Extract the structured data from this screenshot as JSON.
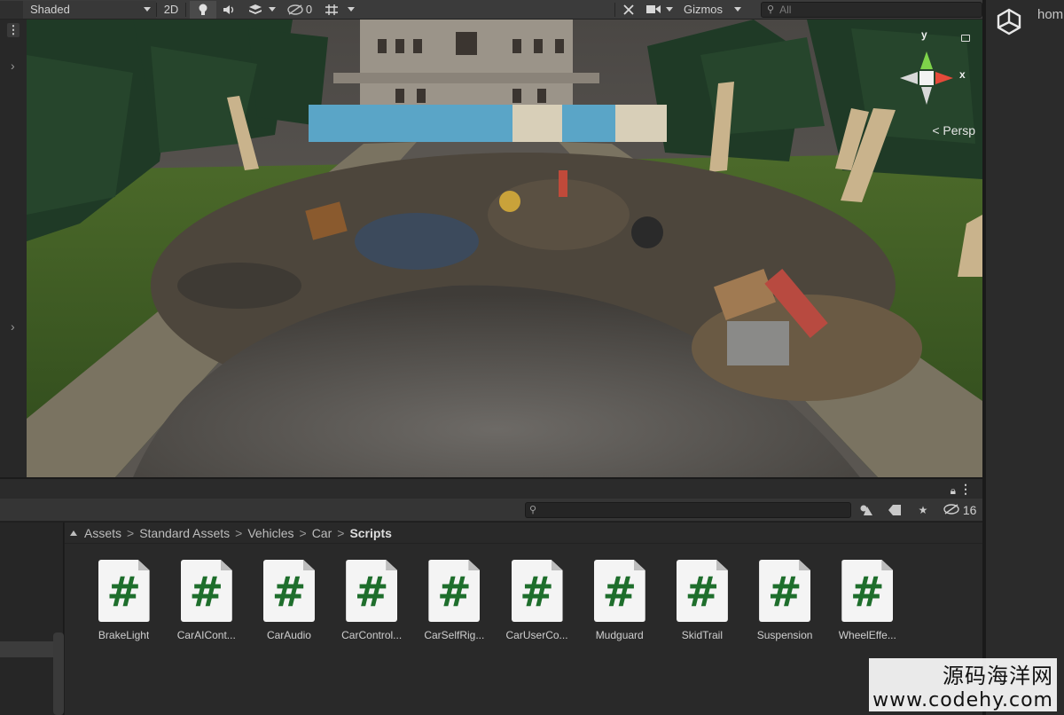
{
  "scene_toolbar": {
    "shading_mode": "Shaded",
    "mode_2d": "2D",
    "hidden_count": "0",
    "gizmos_label": "Gizmos",
    "search_placeholder": "All"
  },
  "scene_view": {
    "projection_label": "< Persp",
    "gizmo_axes": {
      "y": "y",
      "x": "x"
    }
  },
  "right_panel": {
    "title": "hom"
  },
  "project_panel": {
    "hidden_count": "16",
    "breadcrumb": [
      "Assets",
      "Standard Assets",
      "Vehicles",
      "Car"
    ],
    "breadcrumb_current": "Scripts",
    "assets": [
      {
        "label": "BrakeLight",
        "icon": "csharp-script-icon"
      },
      {
        "label": "CarAICont...",
        "icon": "csharp-script-icon"
      },
      {
        "label": "CarAudio",
        "icon": "csharp-script-icon"
      },
      {
        "label": "CarControl...",
        "icon": "csharp-script-icon"
      },
      {
        "label": "CarSelfRig...",
        "icon": "csharp-script-icon"
      },
      {
        "label": "CarUserCo...",
        "icon": "csharp-script-icon"
      },
      {
        "label": "Mudguard",
        "icon": "csharp-script-icon"
      },
      {
        "label": "SkidTrail",
        "icon": "csharp-script-icon"
      },
      {
        "label": "Suspension",
        "icon": "csharp-script-icon"
      },
      {
        "label": "WheelEffe...",
        "icon": "csharp-script-icon"
      }
    ]
  },
  "watermark": {
    "line1": "源码海洋网",
    "line2": "www.codehy.com"
  },
  "colors": {
    "script_hash": "#1e6e2c",
    "panel_bg": "#292929",
    "toolbar_bg": "#3b3b3b"
  }
}
